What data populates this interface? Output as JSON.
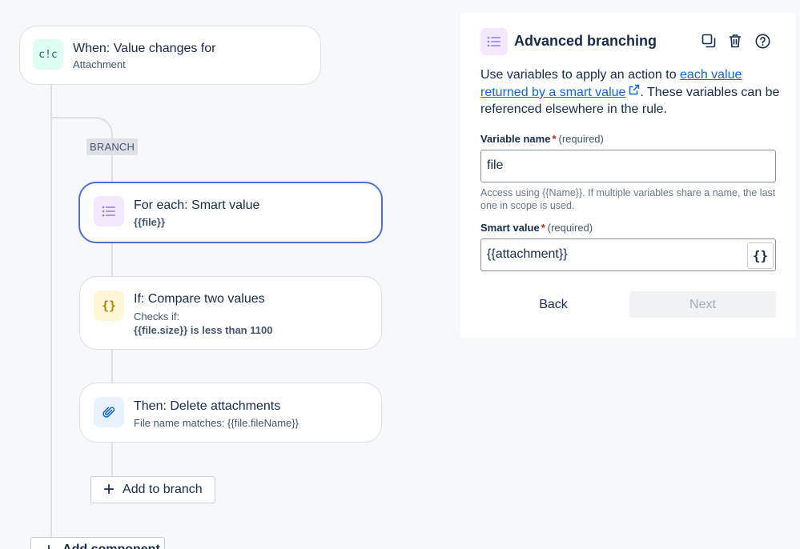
{
  "trigger": {
    "title": "When: Value changes for",
    "subtitle": "Attachment",
    "icon": "value-change-icon",
    "icon_text": "c!c",
    "icon_bg": "#dcfff1",
    "icon_color": "#216e4e"
  },
  "branch": {
    "label": "BRANCH"
  },
  "for_each": {
    "title": "For each: Smart value",
    "subtitle": "{{file}}",
    "icon": "list-icon",
    "icon_bg": "#f3e8fd",
    "icon_color": "#8f7ee7"
  },
  "condition": {
    "title": "If: Compare two values",
    "line1": "Checks if:",
    "line2": "{{file.size}} is less than 1100",
    "icon": "curly-braces-icon",
    "icon_text": "{}",
    "icon_bg": "#fff7d6",
    "icon_color": "#b38600"
  },
  "action": {
    "title": "Then: Delete attachments",
    "subtitle": "File name matches: {{file.fileName}}",
    "icon": "paperclip-icon",
    "icon_bg": "#e9f2ff",
    "icon_color": "#0c66e4"
  },
  "add_to_branch": {
    "label": "Add to branch"
  },
  "add_component": {
    "label": "Add component"
  },
  "panel": {
    "title": "Advanced branching",
    "header_icons": [
      "duplicate-icon",
      "trash-icon",
      "help-icon"
    ],
    "desc_before": "Use variables to apply an action to ",
    "desc_link": "each value returned by a smart value",
    "desc_after": ". These variables can be referenced elsewhere in the rule.",
    "variable_label": "Variable name",
    "required_mark": "*",
    "required_text": "(required)",
    "variable_value": "file",
    "help_text": "Access using {{Name}}. If multiple variables share a name, the last one in scope is used.",
    "smart_label": "Smart value",
    "smart_value": "{{attachment}}",
    "smart_btn": "{}",
    "back": "Back",
    "next": "Next"
  },
  "colors": {
    "accent": "#4c6fd6",
    "link": "#0c66e4",
    "required": "#ae2a19"
  }
}
